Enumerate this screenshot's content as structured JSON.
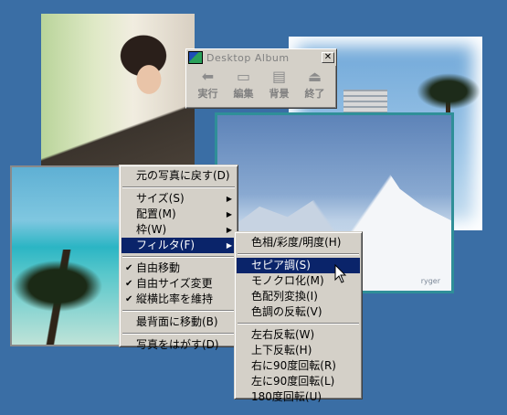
{
  "window": {
    "title": "Desktop Album",
    "close_glyph": "✕",
    "tools": [
      {
        "label": "実行",
        "icon": "arrow-left-icon"
      },
      {
        "label": "編集",
        "icon": "edit-icon"
      },
      {
        "label": "背景",
        "icon": "background-icon"
      },
      {
        "label": "終了",
        "icon": "exit-icon"
      }
    ]
  },
  "context_menu": {
    "items": [
      {
        "label": "元の写真に戻す(D)"
      },
      {
        "label": "サイズ(S)",
        "submenu": true
      },
      {
        "label": "配置(M)",
        "submenu": true
      },
      {
        "label": "枠(W)",
        "submenu": true
      },
      {
        "label": "フィルタ(F)",
        "submenu": true,
        "highlighted": true
      },
      {
        "label": "自由移動",
        "checked": true
      },
      {
        "label": "自由サイズ変更",
        "checked": true
      },
      {
        "label": "縦横比率を維持",
        "checked": true
      },
      {
        "label": "最背面に移動(B)"
      },
      {
        "label": "写真をはがす(D)"
      }
    ]
  },
  "filter_submenu": {
    "items": [
      {
        "label": "色相/彩度/明度(H)"
      },
      {
        "label": "セピア調(S)",
        "highlighted": true
      },
      {
        "label": "モノクロ化(M)"
      },
      {
        "label": "色配列変換(I)"
      },
      {
        "label": "色調の反転(V)"
      },
      {
        "label": "左右反転(W)"
      },
      {
        "label": "上下反転(H)"
      },
      {
        "label": "右に90度回転(R)"
      },
      {
        "label": "左に90度回転(L)"
      },
      {
        "label": "180度回転(U)"
      }
    ]
  },
  "photos": {
    "mountain_signature": "ryger"
  },
  "colors": {
    "desktop": "#3a6ea5",
    "menu_face": "#d4d0c8",
    "highlight": "#0a246a"
  }
}
